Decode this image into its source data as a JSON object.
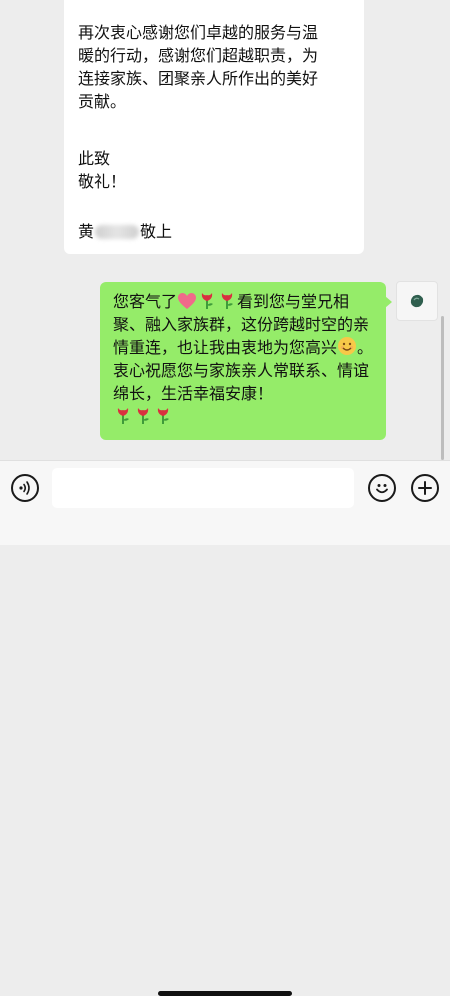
{
  "incoming": {
    "paragraph1": "再次衷心感谢您们卓越的服务与温\n暖的行动，感谢您们超越职责，为\n连接家族、团聚亲人所作出的美好\n贡献。",
    "closing": "此致\n敬礼！",
    "signature_prefix": "黄",
    "signature_suffix": "敬上"
  },
  "outgoing": {
    "part1": "您客气了",
    "part2": "看到您与堂兄相聚、融入家族群，这份跨越时空的亲情重连，也让我由衷地为您高兴",
    "part3": "。衷心祝愿您与家族亲人常联系、情谊绵长，生活幸福安康！"
  },
  "input": {
    "value": "",
    "placeholder": ""
  },
  "icons": {
    "voice": "voice-icon",
    "emoji": "emoji-icon",
    "plus": "plus-icon",
    "heart": "heart-emoji",
    "rose": "rose-emoji",
    "smile": "smile-emoji"
  },
  "colors": {
    "outgoing_bubble": "#95ec69",
    "incoming_bubble": "#ffffff",
    "chat_background": "#ededed"
  }
}
